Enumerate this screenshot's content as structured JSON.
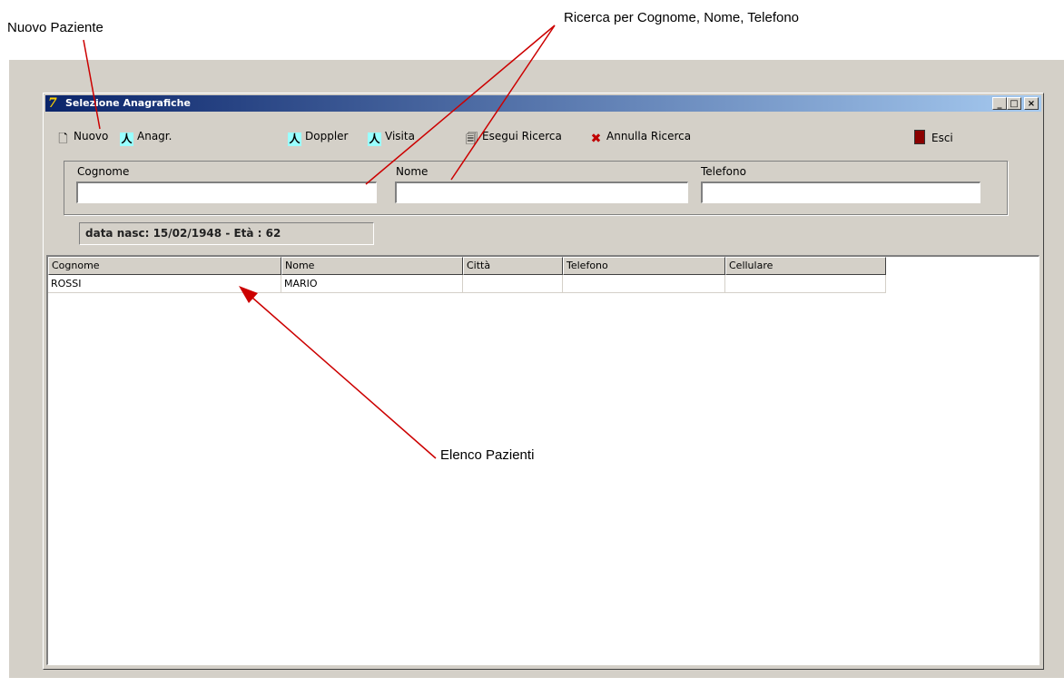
{
  "annotations": {
    "new_patient": "Nuovo Paziente",
    "search": "Ricerca per Cognome, Nome, Telefono",
    "patient_list": "Elenco Pazienti"
  },
  "window": {
    "title": "Selezione Anagrafiche",
    "minimize": "_",
    "maximize": "□",
    "close": "×"
  },
  "toolbar": {
    "nuovo": "Nuovo",
    "anagr": "Anagr.",
    "doppler": "Doppler",
    "visita": "Visita",
    "esegui_ricerca": "Esegui Ricerca",
    "annulla_ricerca": "Annulla Ricerca",
    "esci": "Esci"
  },
  "search": {
    "cognome_label": "Cognome",
    "nome_label": "Nome",
    "telefono_label": "Telefono",
    "cognome_value": "",
    "nome_value": "",
    "telefono_value": ""
  },
  "status": {
    "dob": "data nasc: 15/02/1948 - Età : 62"
  },
  "table": {
    "headers": [
      "Cognome",
      "Nome",
      "Città",
      "Telefono",
      "Cellulare"
    ],
    "rows": [
      [
        "ROSSI",
        "MARIO",
        "",
        "",
        ""
      ]
    ]
  },
  "colors": {
    "annotation_arrow": "#cc0000",
    "titlebar_start": "#0a246a",
    "titlebar_end": "#a6caf0",
    "window_face": "#d4d0c8"
  },
  "icons": {
    "nuovo": "new-document-icon",
    "anagr": "running-man-icon",
    "doppler": "running-man-icon",
    "visita": "running-man-icon",
    "esegui_ricerca": "search-document-icon",
    "annulla_ricerca": "red-x-icon",
    "esci": "exit-door-icon"
  }
}
